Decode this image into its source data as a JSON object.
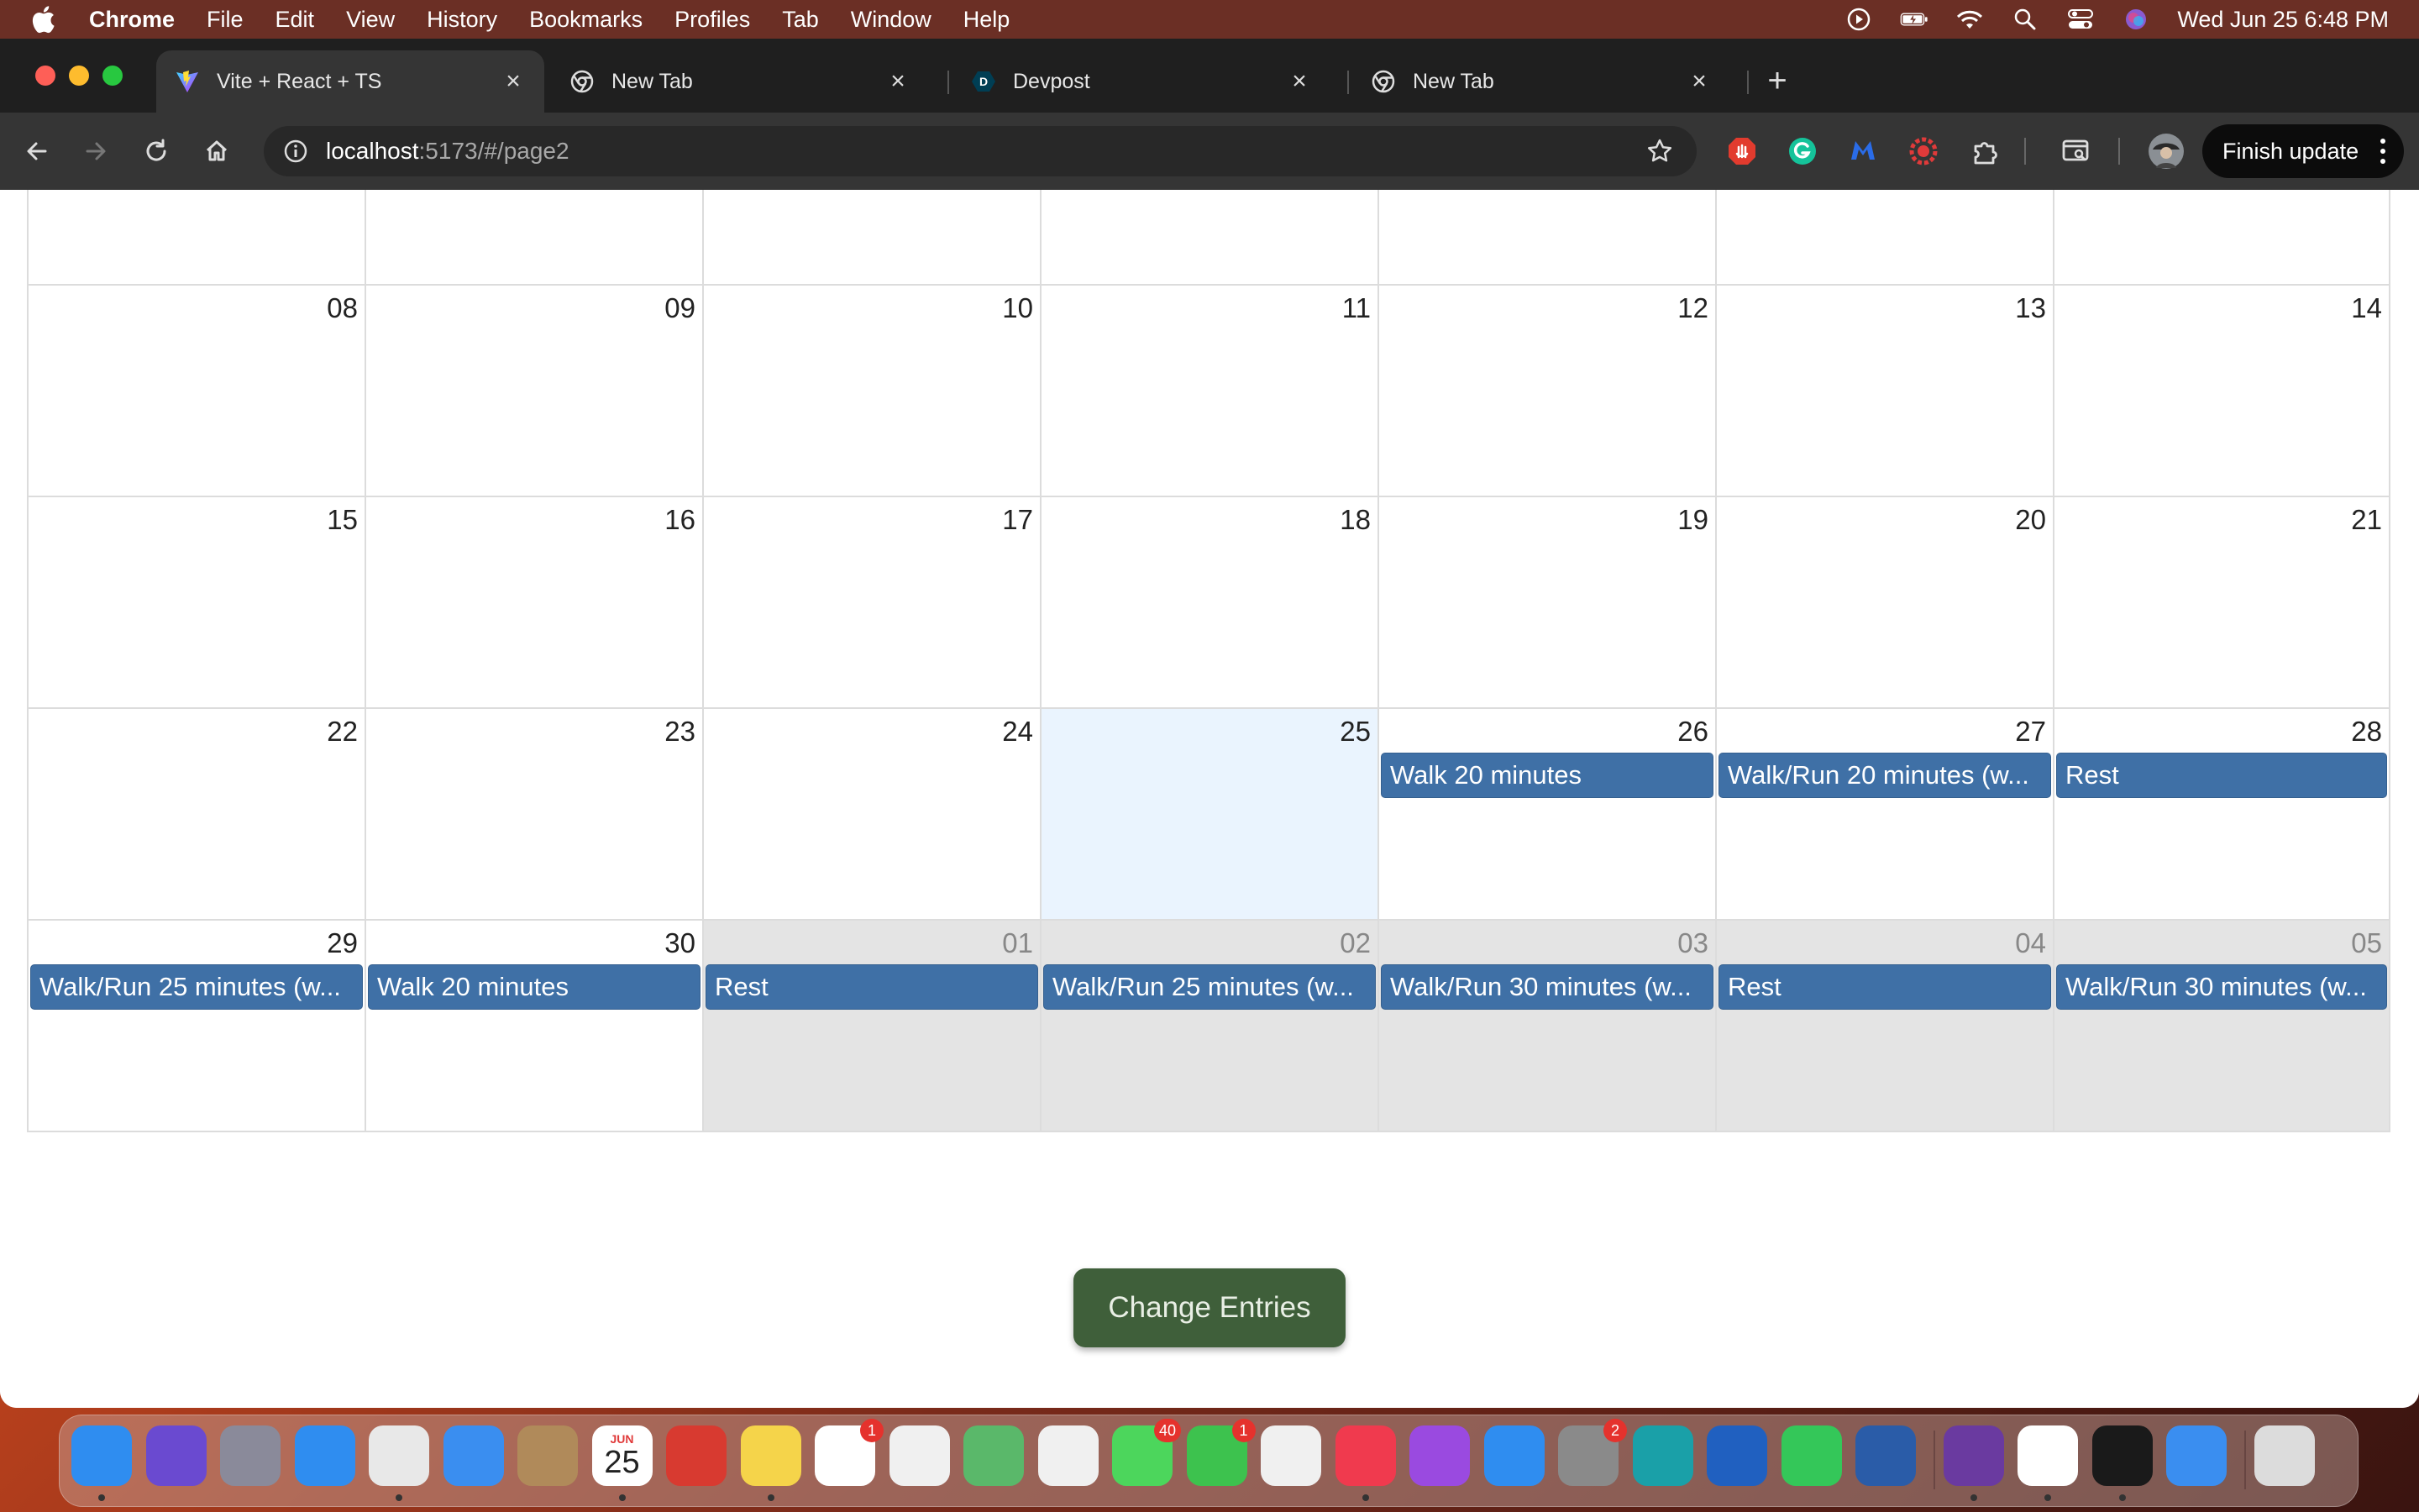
{
  "menubar": {
    "app_name": "Chrome",
    "items": [
      "File",
      "Edit",
      "View",
      "History",
      "Bookmarks",
      "Profiles",
      "Tab",
      "Window",
      "Help"
    ],
    "clock": "Wed Jun 25  6:48 PM"
  },
  "browser": {
    "tabs": [
      {
        "title": "Vite + React + TS",
        "icon": "vite-icon",
        "active": true
      },
      {
        "title": "New Tab",
        "icon": "chrome-icon",
        "active": false
      },
      {
        "title": "Devpost",
        "icon": "devpost-icon",
        "active": false
      },
      {
        "title": "New Tab",
        "icon": "chrome-icon",
        "active": false
      }
    ],
    "url_host": "localhost",
    "url_path": ":5173/#/page2",
    "finish_update_label": "Finish update"
  },
  "calendar": {
    "rows": [
      {
        "kind": "partial",
        "days": [
          {
            "num": ""
          },
          {
            "num": ""
          },
          {
            "num": ""
          },
          {
            "num": ""
          },
          {
            "num": ""
          },
          {
            "num": ""
          },
          {
            "num": ""
          }
        ]
      },
      {
        "kind": "full",
        "days": [
          {
            "num": "08"
          },
          {
            "num": "09"
          },
          {
            "num": "10"
          },
          {
            "num": "11"
          },
          {
            "num": "12"
          },
          {
            "num": "13"
          },
          {
            "num": "14"
          }
        ]
      },
      {
        "kind": "full",
        "days": [
          {
            "num": "15"
          },
          {
            "num": "16"
          },
          {
            "num": "17"
          },
          {
            "num": "18"
          },
          {
            "num": "19"
          },
          {
            "num": "20"
          },
          {
            "num": "21"
          }
        ]
      },
      {
        "kind": "full",
        "days": [
          {
            "num": "22"
          },
          {
            "num": "23"
          },
          {
            "num": "24"
          },
          {
            "num": "25",
            "today": true
          },
          {
            "num": "26",
            "event": "Walk 20 minutes"
          },
          {
            "num": "27",
            "event": "Walk/Run 20 minutes (w..."
          },
          {
            "num": "28",
            "event": "Rest"
          }
        ]
      },
      {
        "kind": "full",
        "days": [
          {
            "num": "29",
            "event": "Walk/Run 25 minutes (w..."
          },
          {
            "num": "30",
            "event": "Walk 20 minutes"
          },
          {
            "num": "01",
            "other": true,
            "event": "Rest"
          },
          {
            "num": "02",
            "other": true,
            "event": "Walk/Run 25 minutes (w..."
          },
          {
            "num": "03",
            "other": true,
            "event": "Walk/Run 30 minutes (w..."
          },
          {
            "num": "04",
            "other": true,
            "event": "Rest"
          },
          {
            "num": "05",
            "other": true,
            "event": "Walk/Run 30 minutes (w..."
          }
        ]
      }
    ]
  },
  "change_entries_label": "Change Entries",
  "dock": {
    "calendar_month": "JUN",
    "calendar_day": "25",
    "apps": [
      {
        "name": "finder",
        "color": "#2f8df0",
        "badge": "",
        "running": true
      },
      {
        "name": "siri",
        "color": "#6a4ad0",
        "badge": "",
        "running": false
      },
      {
        "name": "launchpad",
        "color": "#8a8a9a",
        "badge": "",
        "running": false
      },
      {
        "name": "safari",
        "color": "#2f8df0",
        "badge": "",
        "running": false
      },
      {
        "name": "chrome",
        "color": "#e8e8e8",
        "badge": "",
        "running": true
      },
      {
        "name": "mail",
        "color": "#3a8ef0",
        "badge": "",
        "running": false
      },
      {
        "name": "contacts",
        "color": "#b08a5a",
        "badge": "",
        "running": false
      },
      {
        "name": "calendar",
        "color": "#ffffff",
        "badge": "",
        "running": true
      },
      {
        "name": "photo-booth",
        "color": "#d83a30",
        "badge": "",
        "running": false
      },
      {
        "name": "notes",
        "color": "#f5d44a",
        "badge": "",
        "running": true
      },
      {
        "name": "reminders",
        "color": "#ffffff",
        "badge": "1",
        "running": false
      },
      {
        "name": "freeform",
        "color": "#f0f0f0",
        "badge": "",
        "running": false
      },
      {
        "name": "maps",
        "color": "#5ab86a",
        "badge": "",
        "running": false
      },
      {
        "name": "photos",
        "color": "#f0f0f0",
        "badge": "",
        "running": false
      },
      {
        "name": "messages",
        "color": "#4cd65c",
        "badge": "40",
        "running": false
      },
      {
        "name": "facetime",
        "color": "#3dc24e",
        "badge": "1",
        "running": false
      },
      {
        "name": "news",
        "color": "#f0f0f0",
        "badge": "",
        "running": false
      },
      {
        "name": "music",
        "color": "#f03a4e",
        "badge": "",
        "running": true
      },
      {
        "name": "podcasts",
        "color": "#9a4ae0",
        "badge": "",
        "running": false
      },
      {
        "name": "app-store",
        "color": "#2f8df0",
        "badge": "",
        "running": false
      },
      {
        "name": "system-settings",
        "color": "#8a8a8a",
        "badge": "2",
        "running": false
      },
      {
        "name": "arduino",
        "color": "#1aa0a8",
        "badge": "",
        "running": false
      },
      {
        "name": "remote-desktop",
        "color": "#2060c0",
        "badge": "",
        "running": false
      },
      {
        "name": "whatsapp",
        "color": "#34c759",
        "badge": "",
        "running": false
      },
      {
        "name": "kicad",
        "color": "#2a5ca8",
        "badge": "",
        "running": false
      },
      {
        "name": "github-desktop",
        "color": "#6a3aa0",
        "badge": "",
        "running": true
      },
      {
        "name": "vscode",
        "color": "#ffffff",
        "badge": "",
        "running": true
      },
      {
        "name": "terminal",
        "color": "#1a1a1a",
        "badge": "",
        "running": true
      },
      {
        "name": "weather",
        "color": "#3a8ef0",
        "badge": "",
        "running": false
      },
      {
        "name": "trash",
        "color": "#dcdcdc",
        "badge": "",
        "running": false
      }
    ]
  }
}
